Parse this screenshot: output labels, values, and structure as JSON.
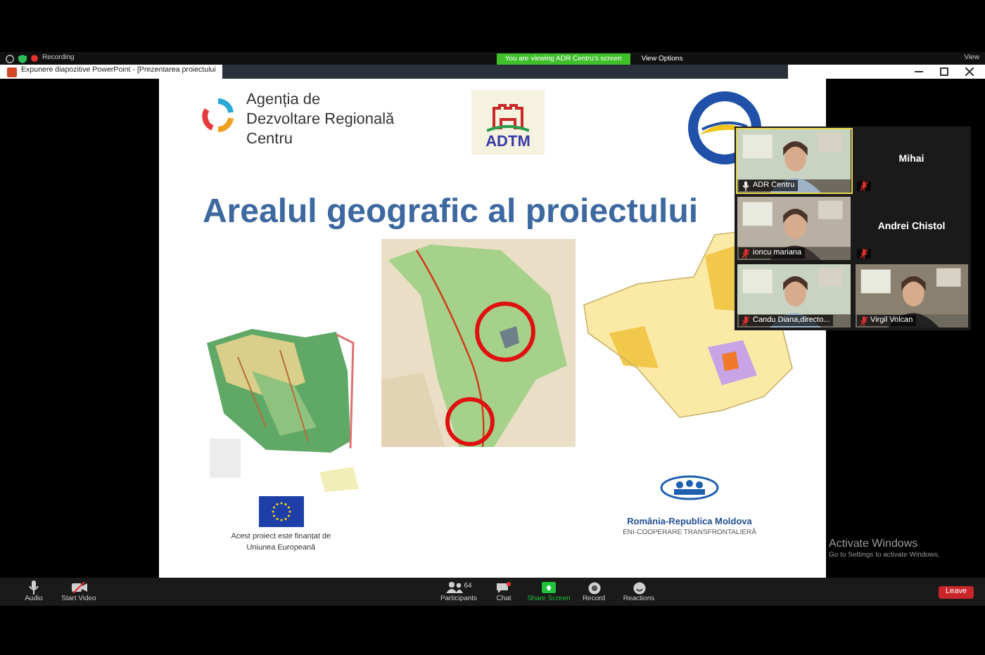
{
  "zoom_bar": {
    "recording": "Recording",
    "sharing_notice": "You are viewing ADR Centru's screen",
    "view_options": "View Options",
    "view": "View"
  },
  "presentation_window": {
    "title": "Expunere diapozitive PowerPoint - [Prezentarea proiectului"
  },
  "slide": {
    "agency_lines": [
      "Agenția de",
      "Dezvoltare Regională",
      "Centru"
    ],
    "logo_text": "ADTM",
    "heading": "Arealul geografic al proiectului",
    "maps": [
      {
        "kind": "picture"
      },
      {
        "kind": "picture"
      },
      {
        "kind": "picture"
      }
    ],
    "eu_caption_lines": [
      "Acest proiect este finanțat de",
      "Uniunea Europeană"
    ],
    "program_name": "România-Republica Moldova",
    "program_subtitle": "ENI-COOPERARE TRANSFRONTALIERĂ"
  },
  "participants": [
    {
      "name": "ADR Centru",
      "video": true,
      "muted": false,
      "speaking": true
    },
    {
      "name": "Mihai",
      "video": false,
      "muted": true,
      "speaking": false
    },
    {
      "name": "ioncu mariana",
      "video": true,
      "muted": true,
      "speaking": false
    },
    {
      "name": "Andrei Chistol",
      "video": false,
      "muted": true,
      "speaking": false
    },
    {
      "name": "Candu Diana,directo...",
      "video": true,
      "muted": true,
      "speaking": false
    },
    {
      "name": "Virgil Volcan",
      "video": true,
      "muted": true,
      "speaking": false
    }
  ],
  "activation_notice": {
    "title": "Activate Windows",
    "subtitle": "Go to Settings to activate Windows."
  },
  "toolbar": {
    "items": [
      {
        "kind": "audio",
        "label": "Audio"
      },
      {
        "kind": "video",
        "label": "Start Video"
      },
      {
        "kind": "participants",
        "label": "Participants",
        "count": "64"
      },
      {
        "kind": "chat",
        "label": "Chat"
      },
      {
        "kind": "share",
        "label": "Share Screen"
      },
      {
        "kind": "record",
        "label": "Record"
      },
      {
        "kind": "reactions",
        "label": "Reactions"
      }
    ],
    "leave": "Leave"
  }
}
